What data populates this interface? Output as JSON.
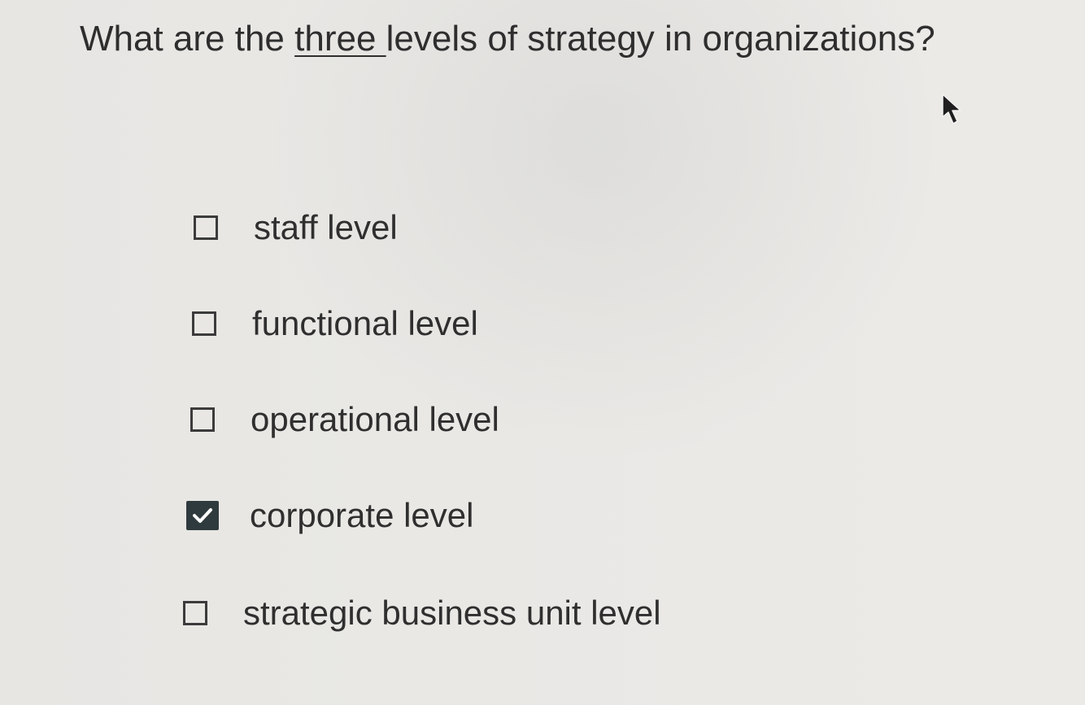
{
  "question": {
    "before": "What are the ",
    "emphasis": "three ",
    "after": "levels of strategy in organizations?"
  },
  "options": [
    {
      "label": "staff level",
      "checked": false
    },
    {
      "label": "functional level",
      "checked": false
    },
    {
      "label": "operational level",
      "checked": false
    },
    {
      "label": "corporate level",
      "checked": true
    },
    {
      "label": "strategic business unit level",
      "checked": false
    }
  ],
  "icons": {
    "cursor": "mouse-pointer-icon",
    "check": "checkmark-icon"
  },
  "colors": {
    "checked_fill": "#2f3a3e",
    "text": "#2f2f2f"
  }
}
